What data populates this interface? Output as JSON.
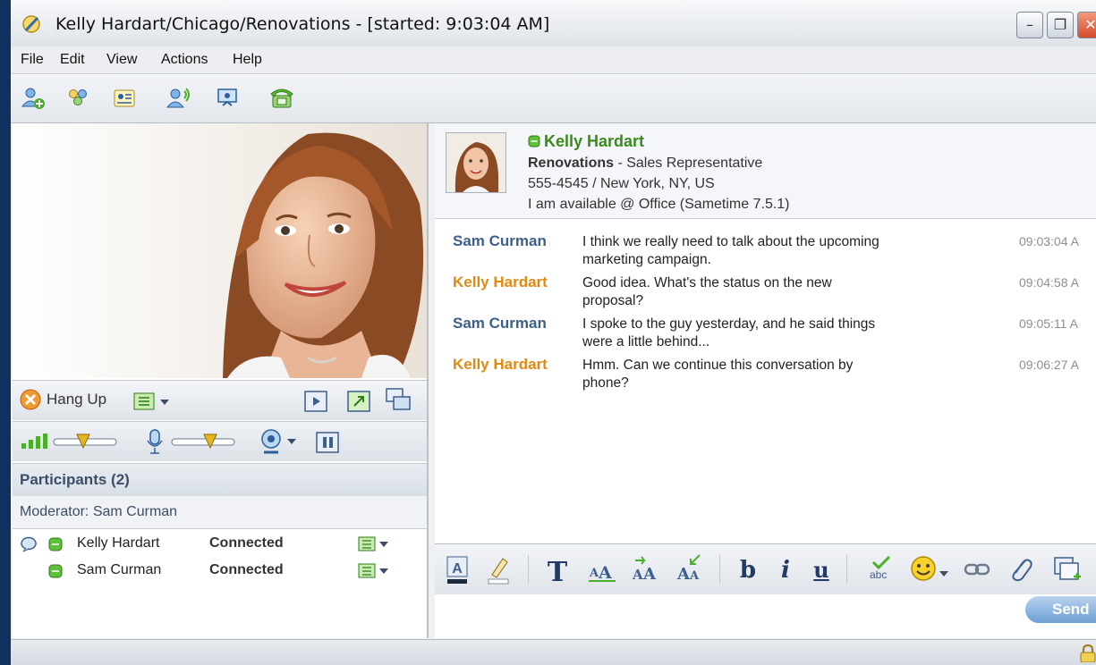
{
  "window": {
    "title": "Kelly Hardart/Chicago/Renovations - [started: 9:03:04 AM]",
    "controls": [
      "minimize",
      "restore",
      "close"
    ]
  },
  "menu": [
    "File",
    "Edit",
    "View",
    "Actions",
    "Help"
  ],
  "toolbar_icons": [
    "add-user-icon",
    "add-group-icon",
    "business-card-icon",
    "voice-user-icon",
    "video-conference-icon",
    "phone-icon"
  ],
  "call_controls": {
    "hangup_label": "Hang Up"
  },
  "participants": {
    "header": "Participants (2)",
    "moderator": "Moderator: Sam Curman",
    "list": [
      {
        "name": "Kelly Hardart",
        "status": "Connected"
      },
      {
        "name": "Sam Curman",
        "status": "Connected"
      }
    ]
  },
  "contact": {
    "name": "Kelly Hardart",
    "company": "Renovations",
    "role": " - Sales Representative",
    "phone_location": "555-4545 / New York, NY, US",
    "availability": "I am available @ Office (Sametime 7.5.1)",
    "status_color": "#3a8a1d"
  },
  "messages": [
    {
      "sender": "Sam Curman",
      "text": "I think we really need to talk about the upcoming marketing campaign.",
      "time": "09:03:04 A"
    },
    {
      "sender": "Kelly Hardart",
      "text": "Good idea. What's the status on the new proposal?",
      "time": "09:04:58 A"
    },
    {
      "sender": "Sam Curman",
      "text": "I spoke to the guy yesterday, and he said things were a little behind...",
      "time": "09:05:11 A"
    },
    {
      "sender": "Kelly Hardart",
      "text": "Hmm. Can we continue this conversation by phone?",
      "time": "09:06:27 A"
    }
  ],
  "sender_colors": {
    "Sam Curman": "#3d5f8c",
    "Kelly Hardart": "#e08a12"
  },
  "format_toolbar": {
    "font_label": "T",
    "bold_label": "b",
    "italic_label": "i",
    "underline_label": "u",
    "spell_label": "abc"
  },
  "send_label": "Send"
}
